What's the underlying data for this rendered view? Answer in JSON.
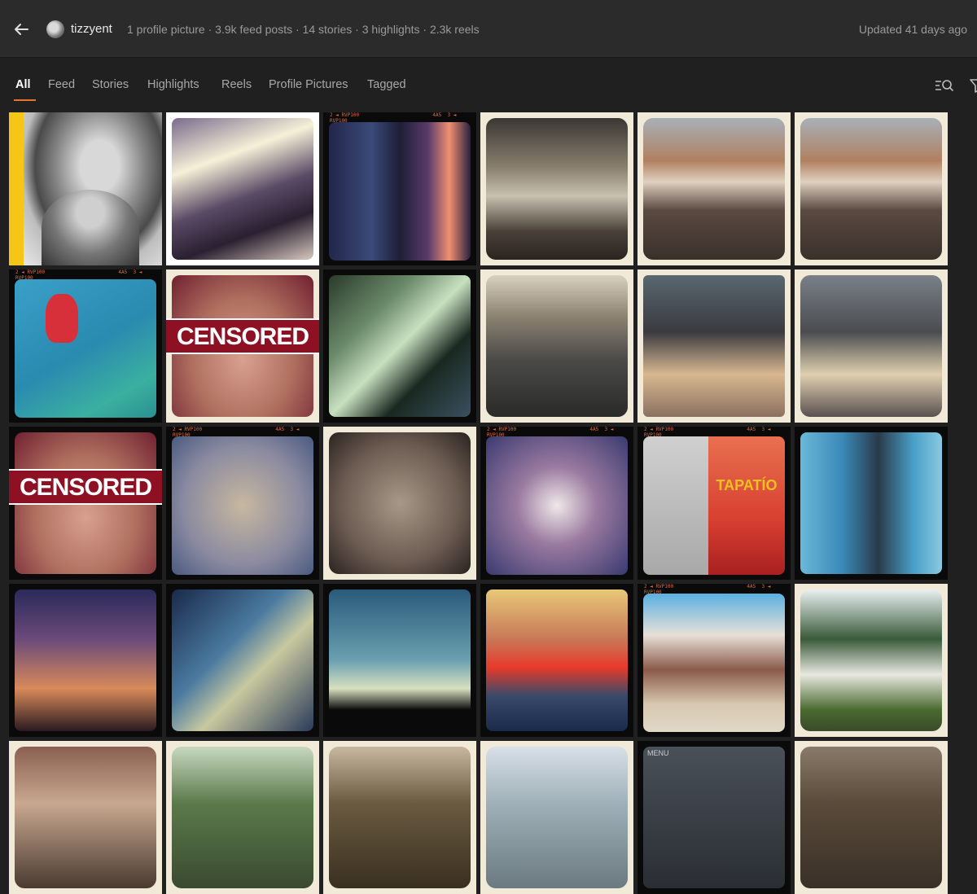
{
  "header": {
    "username": "tizzyent",
    "stats": "1 profile picture · 3.9k feed posts · 14 stories · 3 highlights · 2.3k reels",
    "updated": "Updated 41 days ago"
  },
  "tabs": [
    {
      "label": "All",
      "active": true
    },
    {
      "label": "Feed"
    },
    {
      "label": "Stories"
    },
    {
      "label": "Highlights"
    },
    {
      "label": "Reels"
    },
    {
      "label": "Profile Pictures"
    },
    {
      "label": "Tagged"
    }
  ],
  "icons": {
    "back": "arrow-left-icon",
    "search_list": "list-search-icon",
    "filter": "filter-icon"
  },
  "accent_color": "#e8732a",
  "tiles": [
    {
      "caption": ""
    },
    {
      "caption": ""
    },
    {
      "caption": ""
    },
    {
      "caption": ""
    },
    {
      "caption": ""
    },
    {
      "caption": ""
    },
    {
      "caption": ""
    },
    {
      "caption": "CENSORED"
    },
    {
      "caption": ""
    },
    {
      "caption": ""
    },
    {
      "caption": ""
    },
    {
      "caption": ""
    },
    {
      "caption": "CENSORED"
    },
    {
      "caption": ""
    },
    {
      "caption": ""
    },
    {
      "caption": ""
    },
    {
      "caption": "TAPATÍO"
    },
    {
      "caption": ""
    },
    {
      "caption": ""
    },
    {
      "caption": ""
    },
    {
      "caption": ""
    },
    {
      "caption": ""
    },
    {
      "caption": ""
    },
    {
      "caption": ""
    },
    {
      "caption": ""
    },
    {
      "caption": ""
    },
    {
      "caption": ""
    },
    {
      "caption": ""
    },
    {
      "caption": "MENU"
    },
    {
      "caption": ""
    }
  ]
}
